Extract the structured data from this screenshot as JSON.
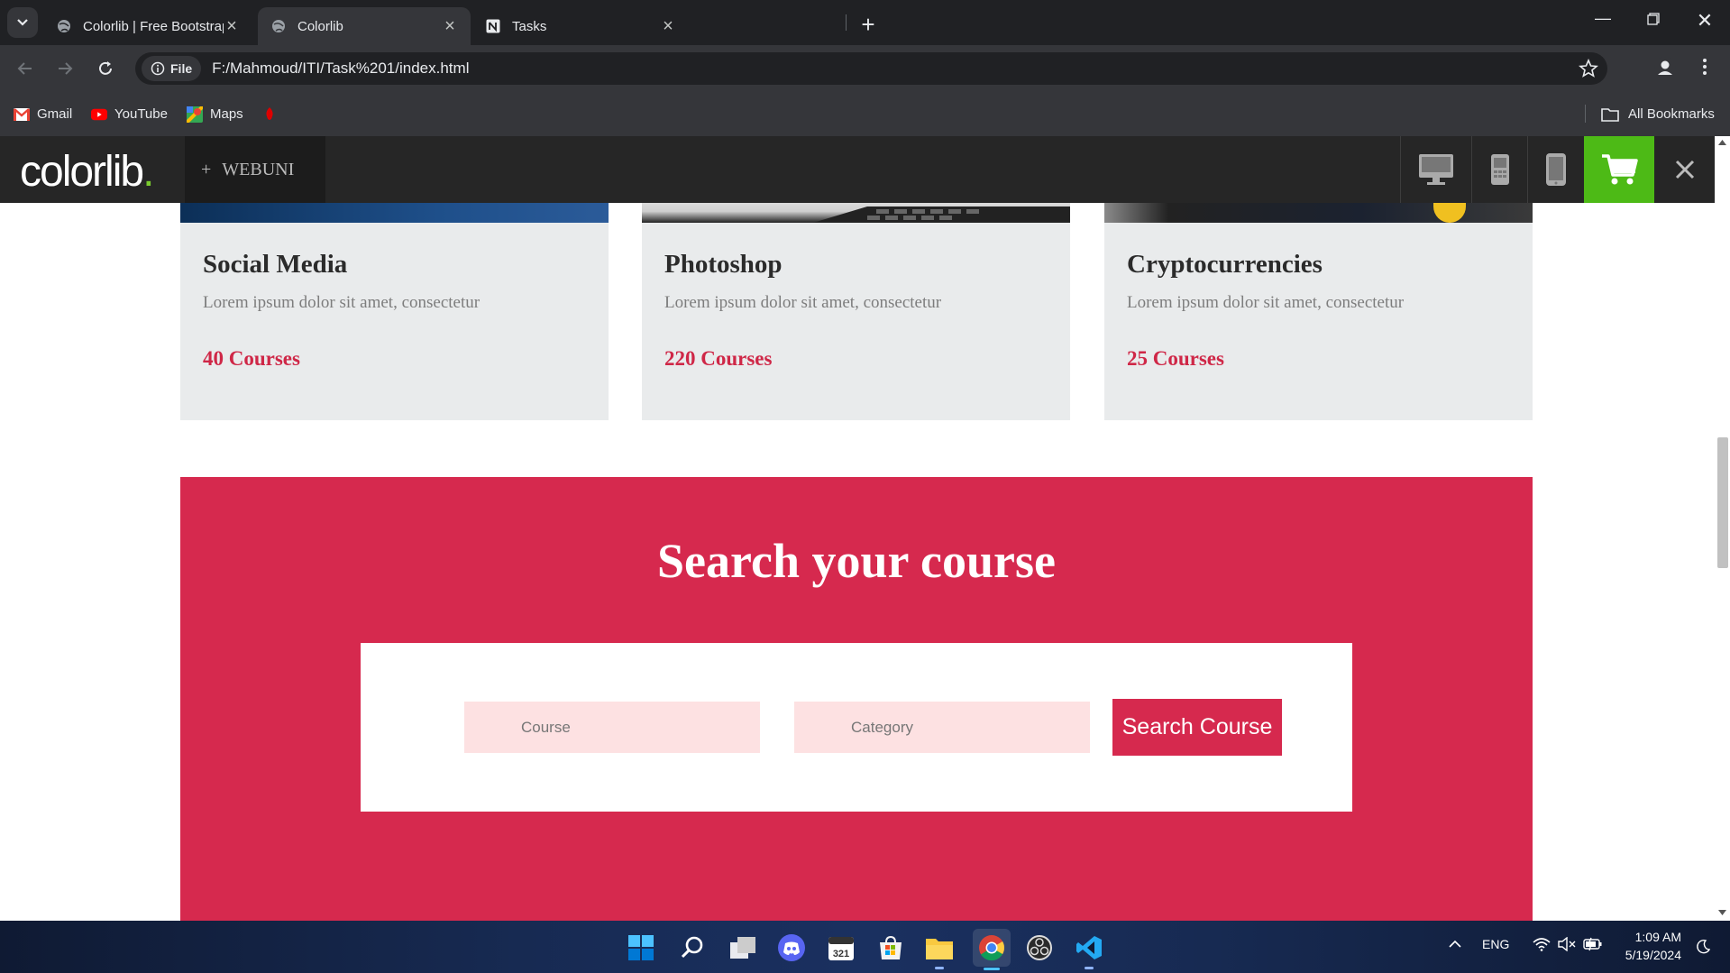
{
  "browser": {
    "tabs": [
      {
        "label": "Colorlib | Free Bootstrap Websit",
        "active": false
      },
      {
        "label": "Colorlib",
        "active": true
      },
      {
        "label": "Tasks",
        "active": false
      }
    ],
    "address": {
      "scheme_label": "File",
      "url": "F:/Mahmoud/ITI/Task%201/index.html"
    },
    "bookmarks": [
      "Gmail",
      "YouTube",
      "Maps"
    ],
    "all_bookmarks_label": "All Bookmarks"
  },
  "page": {
    "logo": {
      "text": "colorlib",
      "dot": "."
    },
    "theme_button": {
      "plus": "+",
      "label": "WEBUNI"
    },
    "cards": [
      {
        "title": "Social Media",
        "text": "Lorem ipsum dolor sit amet, consectetur",
        "count": "40 Courses"
      },
      {
        "title": "Photoshop",
        "text": "Lorem ipsum dolor sit amet, consectetur",
        "count": "220 Courses"
      },
      {
        "title": "Cryptocurrencies",
        "text": "Lorem ipsum dolor sit amet, consectetur",
        "count": "25 Courses"
      }
    ],
    "search": {
      "title": "Search your course",
      "course_placeholder": "Course",
      "category_placeholder": "Category",
      "button_label": "Search Course"
    },
    "colors": {
      "accent": "#d6294e",
      "cart": "#4dba16",
      "input_bg": "#fde1e2"
    }
  },
  "taskbar": {
    "icons": [
      "windows-start-icon",
      "search-icon",
      "task-view-icon",
      "discord-icon",
      "calendar-app-icon",
      "microsoft-store-icon",
      "file-explorer-icon",
      "chrome-icon",
      "obs-icon",
      "vscode-icon"
    ],
    "language": "ENG",
    "time": "1:09 AM",
    "date": "5/19/2024"
  }
}
